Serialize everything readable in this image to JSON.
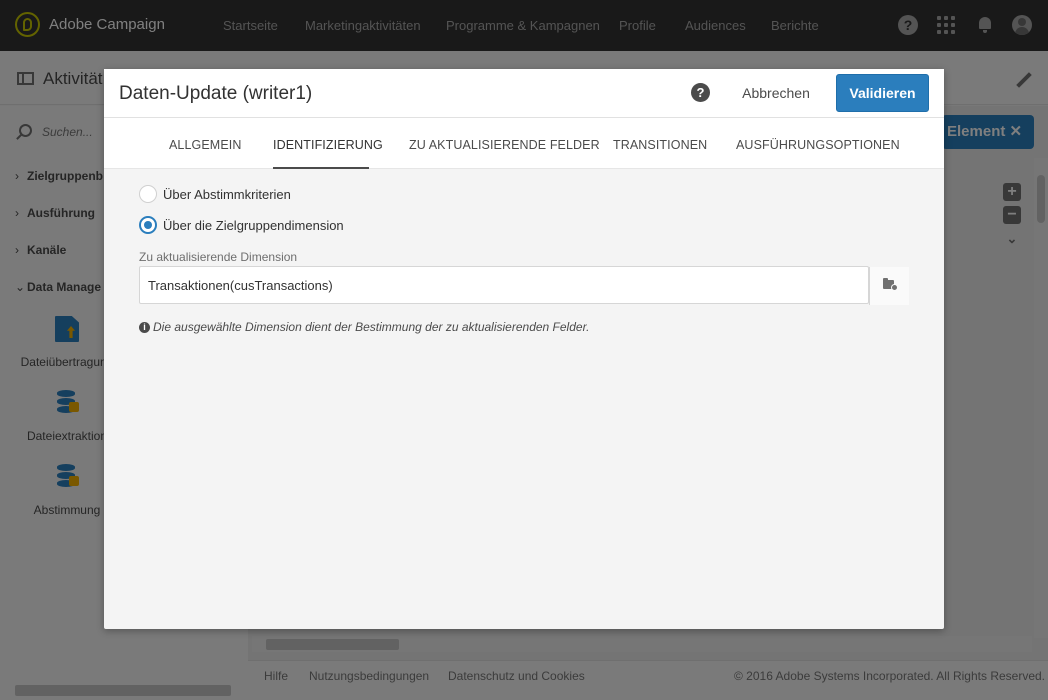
{
  "topbar": {
    "app_name": "Adobe Campaign",
    "nav": [
      "Startseite",
      "Marketingaktivitäten",
      "Programme & Kampagnen",
      "Profile",
      "Audiences",
      "Berichte"
    ],
    "help_glyph": "?",
    "icons": [
      "help-icon",
      "apps-grid-icon",
      "bell-icon",
      "user-avatar-icon"
    ]
  },
  "page": {
    "title": "Aktivität",
    "search_placeholder": "Suchen...",
    "sidebar_groups": [
      {
        "label": "Zielgruppenb",
        "expanded": false
      },
      {
        "label": "Ausführung",
        "expanded": false
      },
      {
        "label": "Kanäle",
        "expanded": false
      },
      {
        "label": "Data Manage",
        "expanded": true
      }
    ],
    "chevrons": {
      "collapsed": "›",
      "expanded": "⌄"
    },
    "activities": [
      "Dateiübertragung",
      "Dateiextraktion",
      "Abstimmung"
    ],
    "element_button": "Element",
    "element_close": "✕",
    "zoom": {
      "plus": "+",
      "minus": "−",
      "more": "⌄"
    },
    "footer": {
      "links": [
        "Hilfe",
        "Nutzungsbedingungen",
        "Datenschutz und Cookies"
      ],
      "copyright": "© 2016 Adobe Systems Incorporated. All Rights Reserved."
    }
  },
  "modal": {
    "title": "Daten-Update (writer1)",
    "help_glyph": "?",
    "cancel": "Abbrechen",
    "validate": "Validieren",
    "tabs": [
      "ALLGEMEIN",
      "IDENTIFIZIERUNG",
      "ZU AKTUALISIERENDE FELDER",
      "TRANSITIONEN",
      "AUSFÜHRUNGSOPTIONEN"
    ],
    "active_tab": "IDENTIFIZIERUNG",
    "radio_options": [
      {
        "label": "Über Abstimmkriterien",
        "checked": false
      },
      {
        "label": "Über die Zielgruppendimension",
        "checked": true
      }
    ],
    "dimension_label": "Zu aktualisierende Dimension",
    "dimension_value": "Transaktionen(cusTransactions)",
    "info_glyph": "i",
    "info_text": "Die ausgewählte Dimension dient der Bestimmung der zu aktualisierenden Felder."
  },
  "colors": {
    "topbar": "#323232",
    "accent": "#2b7ebd",
    "logo": "#c6c600"
  }
}
